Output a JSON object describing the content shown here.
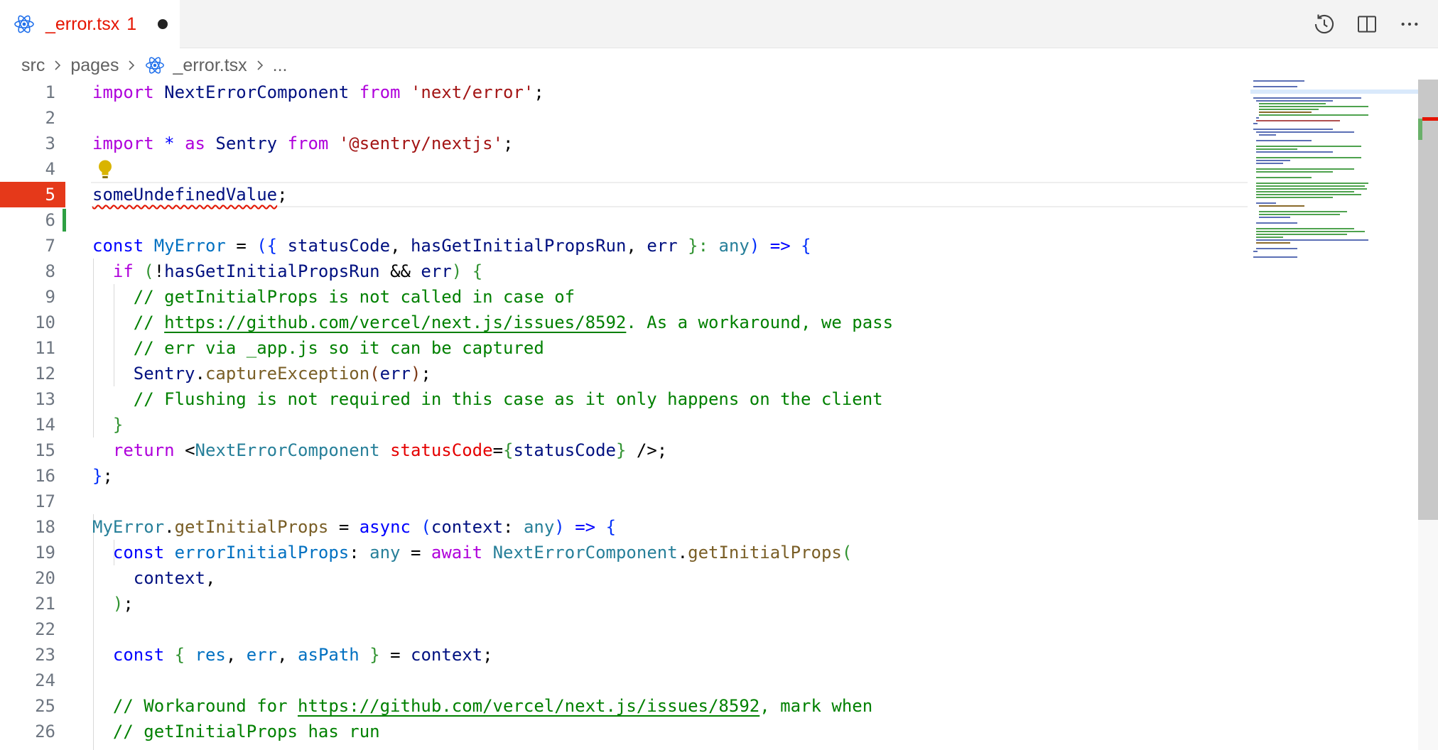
{
  "tab": {
    "filename": "_error.tsx",
    "error_count": "1",
    "icon": "react-icon",
    "dirty": true
  },
  "actions": [
    {
      "icon": "history-icon"
    },
    {
      "icon": "split-editor-icon"
    },
    {
      "icon": "more-actions-icon"
    }
  ],
  "breadcrumb": {
    "items": [
      "src",
      "pages",
      "_error.tsx",
      "..."
    ]
  },
  "colors": {
    "error": "#e51400",
    "error_gutter": "#e5391a",
    "modified_gutter": "#2ea043",
    "keyword": "#0000ff",
    "control_keyword": "#af00db",
    "string": "#a31515",
    "type": "#267f99",
    "comment": "#008000",
    "variable": "#001080",
    "function": "#795e26"
  },
  "editor": {
    "line_numbers": [
      "1",
      "2",
      "3",
      "4",
      "5",
      "6",
      "7",
      "8",
      "9",
      "10",
      "11",
      "12",
      "13",
      "14",
      "15",
      "16",
      "17",
      "18",
      "19",
      "20",
      "21",
      "22",
      "23",
      "24",
      "25",
      "26"
    ],
    "current_line": "5",
    "lines": {
      "l1": {
        "kw_import": "import",
        "name": "NextErrorComponent",
        "kw_from": "from",
        "str": "'next/error'",
        "semi": ";"
      },
      "l3": {
        "kw_import": "import",
        "star": "*",
        "kw_as": "as",
        "name": "Sentry",
        "kw_from": "from",
        "str": "'@sentry/nextjs'",
        "semi": ";"
      },
      "l5": {
        "name": "someUndefinedValue",
        "semi": ";"
      },
      "l7": {
        "kw": "const",
        "name": "MyError",
        "eq": "=",
        "open": "({",
        "a1": "statusCode",
        "a2": "hasGetInitialPropsRun",
        "a3": "err",
        "close": "}:",
        "type": "any",
        "arrow": ")",
        "fat": "=>",
        "brace": "{"
      },
      "l8": {
        "kw": "if",
        "paren": "(",
        "bang": "!",
        "a1": "hasGetInitialPropsRun",
        "and": "&&",
        "a2": "err",
        "close": ")",
        "brace": "{"
      },
      "l9": {
        "comment": "// getInitialProps is not called in case of"
      },
      "l10": {
        "pre": "// ",
        "url": "https://github.com/vercel/next.js/issues/8592",
        "post": ". As a workaround, we pass"
      },
      "l11": {
        "comment": "// err via _app.js so it can be captured"
      },
      "l12": {
        "obj": "Sentry",
        "dot": ".",
        "fn": "captureException",
        "open": "(",
        "arg": "err",
        "close": ")",
        "semi": ";"
      },
      "l13": {
        "comment": "// Flushing is not required in this case as it only happens on the client"
      },
      "l14": {
        "brace": "}"
      },
      "l15": {
        "kw": "return",
        "lt": "<",
        "comp": "NextErrorComponent",
        "attr": "statusCode",
        "eq": "=",
        "open": "{",
        "val": "statusCode",
        "close": "}",
        "end": " />;"
      },
      "l16": {
        "brace": "}",
        "semi": ";"
      },
      "l18": {
        "obj": "MyError",
        "dot": ".",
        "prop": "getInitialProps",
        "eq": "=",
        "kw": "async",
        "open": "(",
        "arg": "context",
        "colon": ":",
        "type": "any",
        "close": ")",
        "fat": "=>",
        "brace": "{"
      },
      "l19": {
        "kw": "const",
        "name": "errorInitialProps",
        "colon": ":",
        "type": "any",
        "eq": "=",
        "kw2": "await",
        "cls": "NextErrorComponent",
        "dot": ".",
        "fn": "getInitialProps",
        "open": "("
      },
      "l20": {
        "arg": "context",
        "comma": ","
      },
      "l21": {
        "close": ")",
        "semi": ";"
      },
      "l23": {
        "kw": "const",
        "open": "{",
        "a1": "res",
        "a2": "err",
        "a3": "asPath",
        "close": "}",
        "eq": "=",
        "val": "context",
        "semi": ";"
      },
      "l25": {
        "pre": "// Workaround for ",
        "url": "https://github.com/vercel/next.js/issues/8592",
        "post": ", mark when"
      },
      "l26": {
        "comment": "// getInitialProps has run"
      }
    }
  }
}
